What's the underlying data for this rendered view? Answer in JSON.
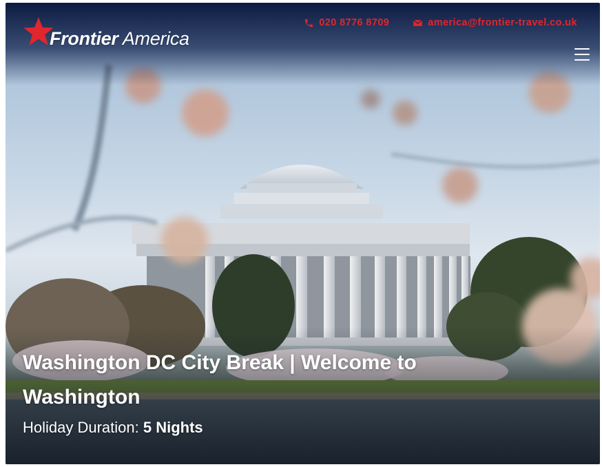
{
  "header": {
    "logo_text_bold": "Frontier",
    "logo_text_regular": "America",
    "phone": "020 8776 8709",
    "email": "america@frontier-travel.co.uk"
  },
  "icons": {
    "logo": "star-icon",
    "phone": "phone-icon",
    "email": "envelope-icon",
    "menu": "hamburger-menu-icon"
  },
  "hero": {
    "title": "Washington DC City Break | Welcome to Washington",
    "duration_label": "Holiday Duration:",
    "duration_value": "5 Nights"
  },
  "colors": {
    "brand_red": "#e1262d",
    "header_navy": "#08153a",
    "text_white": "#ffffff"
  }
}
